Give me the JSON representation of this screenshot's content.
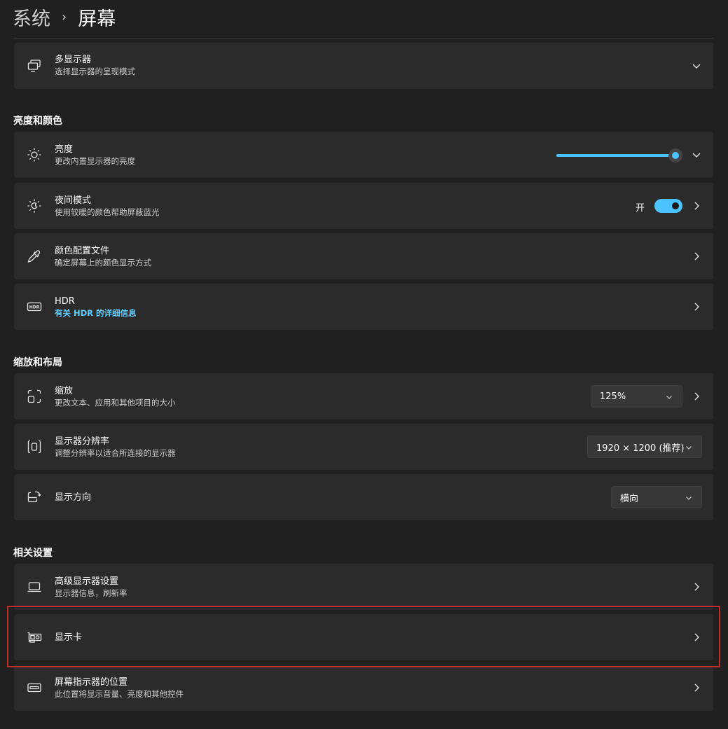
{
  "breadcrumb": {
    "parent": "系统",
    "separator": "›",
    "current": "屏幕"
  },
  "multi_display": {
    "title": "多显示器",
    "subtitle": "选择显示器的呈现模式",
    "icon": "multi-monitor-icon"
  },
  "sections": {
    "brightness_color": "亮度和颜色",
    "scale_layout": "缩放和布局",
    "related": "相关设置"
  },
  "brightness": {
    "title": "亮度",
    "subtitle": "更改内置显示器的亮度",
    "icon": "sun-icon",
    "value_percent": 100,
    "accent": "#4cc2ff"
  },
  "night_light": {
    "title": "夜间模式",
    "subtitle": "使用较暖的颜色帮助屏蔽蓝光",
    "icon": "night-light-icon",
    "toggle_label": "开",
    "toggle_on": true
  },
  "color_profile": {
    "title": "颜色配置文件",
    "subtitle": "确定屏幕上的颜色显示方式",
    "icon": "eyedropper-icon"
  },
  "hdr": {
    "title": "HDR",
    "link": "有关 HDR 的详细信息",
    "icon": "hdr-icon"
  },
  "scale": {
    "title": "缩放",
    "subtitle": "更改文本、应用和其他项目的大小",
    "icon": "scale-icon",
    "value": "125%"
  },
  "resolution": {
    "title": "显示器分辨率",
    "subtitle": "调整分辨率以适合所连接的显示器",
    "icon": "resolution-icon",
    "value": "1920 × 1200 (推荐)"
  },
  "orientation": {
    "title": "显示方向",
    "icon": "rotate-display-icon",
    "value": "横向"
  },
  "advanced_display": {
    "title": "高级显示器设置",
    "subtitle": "显示器信息，刷新率",
    "icon": "laptop-icon"
  },
  "graphics": {
    "title": "显示卡",
    "icon": "graphics-card-icon"
  },
  "taskbar_indicator": {
    "title": "屏幕指示器的位置",
    "subtitle": "此位置将显示音量、亮度和其他控件",
    "icon": "indicator-position-icon"
  },
  "colors": {
    "background": "#202020",
    "card": "#2b2b2b",
    "accent": "#4cc2ff",
    "link": "#60cdff",
    "highlight_border": "#c42b2b"
  }
}
